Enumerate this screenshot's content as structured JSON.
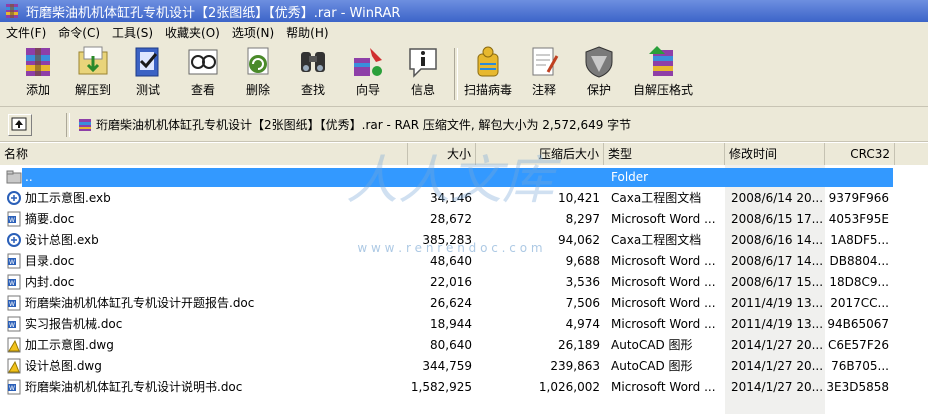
{
  "window": {
    "title": "珩磨柴油机机体缸孔专机设计【2张图纸】【优秀】.rar - WinRAR"
  },
  "menu": [
    "文件(F)",
    "命令(C)",
    "工具(S)",
    "收藏夹(O)",
    "选项(N)",
    "帮助(H)"
  ],
  "toolbar": [
    {
      "label": "添加",
      "icon": "add-archive-icon"
    },
    {
      "label": "解压到",
      "icon": "extract-to-icon"
    },
    {
      "label": "测试",
      "icon": "test-icon"
    },
    {
      "label": "查看",
      "icon": "view-icon"
    },
    {
      "label": "删除",
      "icon": "delete-icon"
    },
    {
      "label": "查找",
      "icon": "find-icon"
    },
    {
      "label": "向导",
      "icon": "wizard-icon"
    },
    {
      "label": "信息",
      "icon": "info-icon"
    },
    {
      "label": "扫描病毒",
      "icon": "virus-scan-icon"
    },
    {
      "label": "注释",
      "icon": "comment-icon"
    },
    {
      "label": "保护",
      "icon": "protect-icon"
    },
    {
      "label": "自解压格式",
      "icon": "sfx-icon"
    }
  ],
  "address": {
    "text": "珩磨柴油机机体缸孔专机设计【2张图纸】【优秀】.rar - RAR 压缩文件, 解包大小为 2,572,649 字节"
  },
  "columns": [
    "名称",
    "大小",
    "压缩后大小",
    "类型",
    "修改时间",
    "CRC32"
  ],
  "rows": [
    {
      "name": "..",
      "size": "",
      "packed": "",
      "type": "Folder",
      "modified": "",
      "crc": "",
      "icon": "folder-up-icon",
      "selected": true
    },
    {
      "name": "加工示意图.exb",
      "size": "34,146",
      "packed": "10,421",
      "type": "Caxa工程图文档",
      "modified": "2008/6/14 20...",
      "crc": "9379F966",
      "icon": "exb-file-icon"
    },
    {
      "name": "摘要.doc",
      "size": "28,672",
      "packed": "8,297",
      "type": "Microsoft Word ...",
      "modified": "2008/6/15 17...",
      "crc": "4053F95E",
      "icon": "word-file-icon"
    },
    {
      "name": "设计总图.exb",
      "size": "385,283",
      "packed": "94,062",
      "type": "Caxa工程图文档",
      "modified": "2008/6/16 14...",
      "crc": "1A8DF5...",
      "icon": "exb-file-icon"
    },
    {
      "name": "目录.doc",
      "size": "48,640",
      "packed": "9,688",
      "type": "Microsoft Word ...",
      "modified": "2008/6/17 14...",
      "crc": "DB8804...",
      "icon": "word-file-icon"
    },
    {
      "name": "内封.doc",
      "size": "22,016",
      "packed": "3,536",
      "type": "Microsoft Word ...",
      "modified": "2008/6/17 15...",
      "crc": "18D8C9...",
      "icon": "word-file-icon"
    },
    {
      "name": "珩磨柴油机机体缸孔专机设计开题报告.doc",
      "size": "26,624",
      "packed": "7,506",
      "type": "Microsoft Word ...",
      "modified": "2011/4/19 13...",
      "crc": "2017CC...",
      "icon": "word-file-icon"
    },
    {
      "name": "实习报告机械.doc",
      "size": "18,944",
      "packed": "4,974",
      "type": "Microsoft Word ...",
      "modified": "2011/4/19 13...",
      "crc": "94B65067",
      "icon": "word-file-icon"
    },
    {
      "name": "加工示意图.dwg",
      "size": "80,640",
      "packed": "26,189",
      "type": "AutoCAD 图形",
      "modified": "2014/1/27 20...",
      "crc": "C6E57F26",
      "icon": "dwg-file-icon"
    },
    {
      "name": "设计总图.dwg",
      "size": "344,759",
      "packed": "239,863",
      "type": "AutoCAD 图形",
      "modified": "2014/1/27 20...",
      "crc": "76B705...",
      "icon": "dwg-file-icon"
    },
    {
      "name": "珩磨柴油机机体缸孔专机设计说明书.doc",
      "size": "1,582,925",
      "packed": "1,026,002",
      "type": "Microsoft Word ...",
      "modified": "2014/1/27 20...",
      "crc": "3E3D5858",
      "icon": "word-file-icon"
    }
  ],
  "watermark": {
    "brand": "人人文库",
    "url": "w w w . r e n r e n d o c . c o m"
  }
}
